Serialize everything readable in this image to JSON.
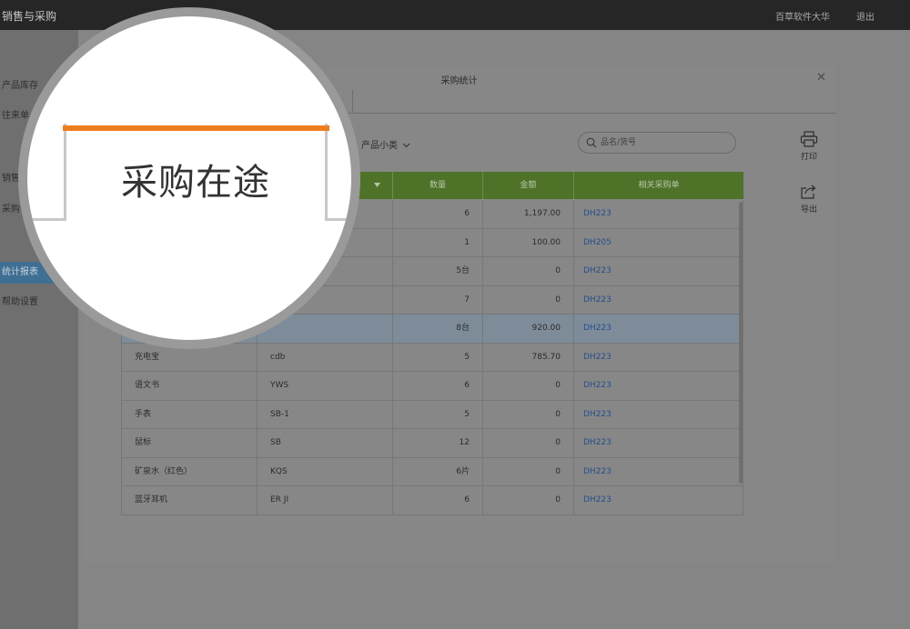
{
  "app": {
    "title": "销售与采购",
    "company": "百草软件大华",
    "logout_label": "退出"
  },
  "sidebar": {
    "items": [
      {
        "label": "产品库存"
      },
      {
        "label": "往来单"
      },
      {
        "label": "销售"
      },
      {
        "label": "采购"
      },
      {
        "label": "统计报表"
      },
      {
        "label": "帮助设置"
      }
    ]
  },
  "modal": {
    "title": "采购统计",
    "close_icon": "close-icon",
    "active_tab": "采购在途",
    "filter_subcategory": "产品小类",
    "search": {
      "placeholder": "品名/货号",
      "value": ""
    },
    "tools": [
      {
        "label": "打印",
        "icon": "printer-icon"
      },
      {
        "label": "导出",
        "icon": "export-icon"
      }
    ],
    "table": {
      "headers": [
        "",
        "",
        "数量",
        "金额",
        "相关采购单"
      ],
      "rows": [
        {
          "name": "",
          "code": "",
          "qty": "6",
          "amount": "1,197.00",
          "order": "DH223"
        },
        {
          "name": "",
          "code": "",
          "qty": "1",
          "amount": "100.00",
          "order": "DH205"
        },
        {
          "name": "",
          "code": "",
          "qty": "5台",
          "amount": "0",
          "order": "DH223"
        },
        {
          "name": "",
          "code": "",
          "qty": "7",
          "amount": "0",
          "order": "DH223"
        },
        {
          "name": "",
          "code": "",
          "qty": "8台",
          "amount": "920.00",
          "order": "DH223"
        },
        {
          "name": "充电宝",
          "code": "cdb",
          "qty": "5",
          "amount": "785.70",
          "order": "DH223"
        },
        {
          "name": "语文书",
          "code": "YWS",
          "qty": "6",
          "amount": "0",
          "order": "DH223"
        },
        {
          "name": "手表",
          "code": "SB-1",
          "qty": "5",
          "amount": "0",
          "order": "DH223"
        },
        {
          "name": "鼠标",
          "code": "SB",
          "qty": "12",
          "amount": "0",
          "order": "DH223"
        },
        {
          "name": "矿泉水（红色）",
          "code": "KQS",
          "qty": "6片",
          "amount": "0",
          "order": "DH223"
        },
        {
          "name": "蓝牙耳机",
          "code": "ER JI",
          "qty": "6",
          "amount": "0",
          "order": "DH223"
        }
      ],
      "selected_row": 4
    }
  },
  "colors": {
    "accent": "#ee7d1f",
    "header_green": "#6aa83a",
    "link_blue": "#2d6bc7"
  }
}
